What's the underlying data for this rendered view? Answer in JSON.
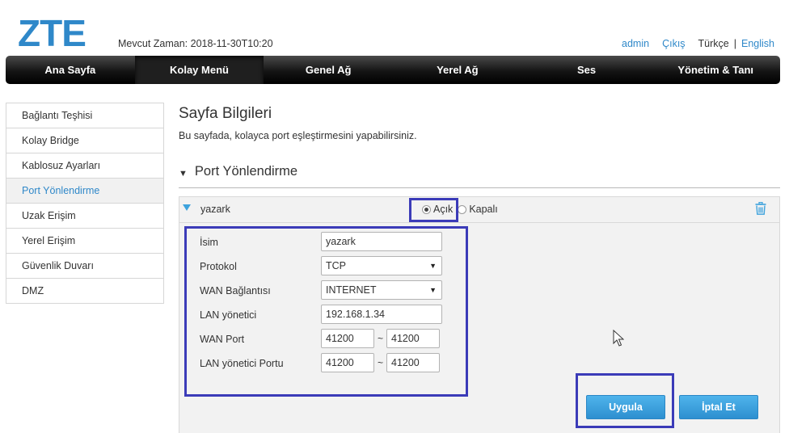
{
  "header": {
    "logo_text": "ZTE",
    "current_time": "Mevcut Zaman: 2018-11-30T10:20",
    "user_link": "admin",
    "logout_link": "Çıkış",
    "lang_turkish": "Türkçe",
    "lang_separator": "|",
    "lang_english": "English"
  },
  "nav": {
    "items": [
      {
        "label": "Ana Sayfa"
      },
      {
        "label": "Kolay Menü"
      },
      {
        "label": "Genel Ağ"
      },
      {
        "label": "Yerel Ağ"
      },
      {
        "label": "Ses"
      },
      {
        "label": "Yönetim & Tanı"
      }
    ],
    "active_index": 1
  },
  "sidebar": {
    "items": [
      {
        "label": "Bağlantı Teşhisi"
      },
      {
        "label": "Kolay Bridge"
      },
      {
        "label": "Kablosuz Ayarları"
      },
      {
        "label": "Port Yönlendirme"
      },
      {
        "label": "Uzak Erişim"
      },
      {
        "label": "Yerel Erişim"
      },
      {
        "label": "Güvenlik Duvarı"
      },
      {
        "label": "DMZ"
      }
    ],
    "active_index": 3
  },
  "page": {
    "title": "Sayfa Bilgileri",
    "description": "Bu sayfada, kolayca port eşleştirmesini yapabilirsiniz.",
    "section_title": "Port Yönlendirme"
  },
  "rule": {
    "name": "yazark",
    "status_on": "Açık",
    "status_off": "Kapalı",
    "status_selected": "on"
  },
  "form": {
    "name_label": "İsim",
    "name_value": "yazark",
    "protocol_label": "Protokol",
    "protocol_value": "TCP",
    "wan_conn_label": "WAN Bağlantısı",
    "wan_conn_value": "INTERNET",
    "lan_host_label": "LAN yönetici",
    "lan_host_value": "192.168.1.34",
    "wan_port_label": "WAN Port",
    "wan_port_start": "41200",
    "wan_port_end": "41200",
    "lan_port_label": "LAN yönetici Portu",
    "lan_port_start": "41200",
    "lan_port_end": "41200",
    "range_separator": "~"
  },
  "buttons": {
    "apply": "Uygula",
    "cancel": "İptal  Et"
  },
  "colors": {
    "accent": "#2f88c9",
    "highlight": "#3b3bb8",
    "nav_bg": "#141414",
    "button": "#3ea3dd"
  },
  "icons": {
    "collapse": "triangle-down-icon",
    "delete": "trash-icon",
    "caret": "chevron-down-icon",
    "cursor": "mouse-pointer-icon"
  }
}
